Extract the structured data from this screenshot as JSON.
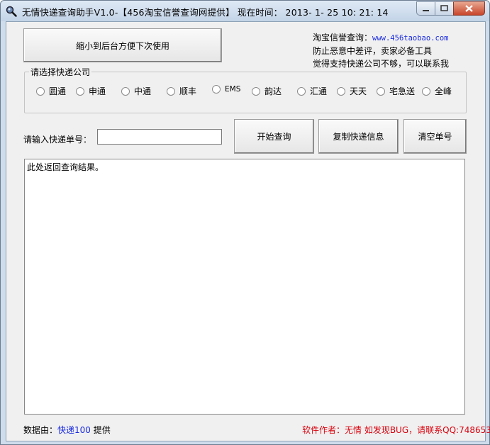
{
  "window": {
    "title": "无情快递查询助手V1.0-【456淘宝信誉查询网提供】  现在时间：  2013- 1- 25  10: 21: 14"
  },
  "top": {
    "minimize_button": "缩小到后台方便下次使用",
    "info_line1_label": "淘宝信誉查询：",
    "info_line1_url": "www.456taobao.com",
    "info_line2": "防止恶意中差评，卖家必备工具",
    "info_line3": "觉得支持快递公司不够，可以联系我"
  },
  "carrier_group": {
    "legend": "请选择快递公司",
    "options": [
      "圆通",
      "申通",
      "中通",
      "顺丰",
      "EMS",
      "韵达",
      "汇通",
      "天天",
      "宅急送",
      "全峰"
    ]
  },
  "query": {
    "label": "请输入快递单号：",
    "value": "",
    "search_button": "开始查询",
    "copy_button": "复制快递信息",
    "clear_button": "清空单号"
  },
  "result": {
    "text": "此处返回查询结果。"
  },
  "footer": {
    "data_by_prefix": "数据由：",
    "data_by_link": "快递100",
    "data_by_suffix": " 提供",
    "author": "软件作者：无情   如发现BUG，请联系QQ:748653"
  },
  "colors": {
    "link": "#1a2be0",
    "author_text": "#d8000c"
  }
}
